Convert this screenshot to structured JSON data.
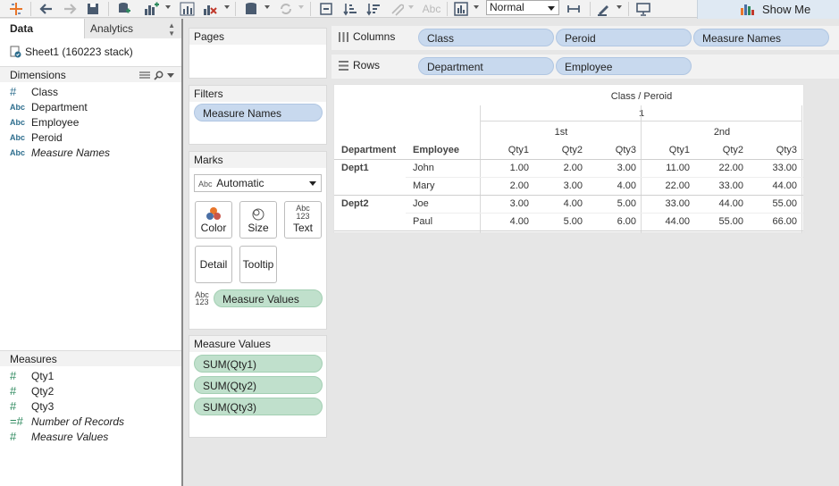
{
  "toolbar": {
    "fit_value": "Normal",
    "show_me_label": "Show Me",
    "label_button": "Abc"
  },
  "data_pane": {
    "tabs": [
      {
        "label": "Data"
      },
      {
        "label": "Analytics"
      }
    ],
    "datasource": "Sheet1 (160223 stack)",
    "dimensions_label": "Dimensions",
    "dimensions": [
      {
        "icon": "#",
        "label": "Class",
        "italic": false
      },
      {
        "icon": "Abc",
        "label": "Department",
        "italic": false
      },
      {
        "icon": "Abc",
        "label": "Employee",
        "italic": false
      },
      {
        "icon": "Abc",
        "label": "Peroid",
        "italic": false
      },
      {
        "icon": "Abc",
        "label": "Measure Names",
        "italic": true
      }
    ],
    "measures_label": "Measures",
    "measures": [
      {
        "icon": "#",
        "label": "Qty1",
        "italic": false
      },
      {
        "icon": "#",
        "label": "Qty2",
        "italic": false
      },
      {
        "icon": "#",
        "label": "Qty3",
        "italic": false
      },
      {
        "icon": "=#",
        "label": "Number of Records",
        "italic": true
      },
      {
        "icon": "#",
        "label": "Measure Values",
        "italic": true
      }
    ]
  },
  "cards": {
    "pages_title": "Pages",
    "filters_title": "Filters",
    "filters": [
      "Measure Names"
    ],
    "marks_title": "Marks",
    "marks_type_icon": "Abc",
    "marks_type": "Automatic",
    "marks_buttons": [
      "Color",
      "Size",
      "Text",
      "Detail",
      "Tooltip"
    ],
    "text_glyph_top": "Abc",
    "text_glyph_bottom": "123",
    "marks_pill": "Measure Values",
    "measure_values_title": "Measure Values",
    "measure_values": [
      "SUM(Qty1)",
      "SUM(Qty2)",
      "SUM(Qty3)"
    ]
  },
  "shelves": {
    "columns_label": "Columns",
    "columns": [
      "Class",
      "Peroid",
      "Measure Names"
    ],
    "rows_label": "Rows",
    "rows": [
      "Department",
      "Employee"
    ]
  },
  "view": {
    "top_header": "Class  /  Peroid",
    "class_value": "1",
    "periods": [
      "1st",
      "2nd"
    ],
    "row_headers": [
      "Department",
      "Employee"
    ],
    "measure_headers": [
      "Qty1",
      "Qty2",
      "Qty3",
      "Qty1",
      "Qty2",
      "Qty3"
    ],
    "rows": [
      {
        "dept": "Dept1",
        "emp": "John",
        "values": [
          "1.00",
          "2.00",
          "3.00",
          "11.00",
          "22.00",
          "33.00"
        ]
      },
      {
        "dept": "",
        "emp": "Mary",
        "values": [
          "2.00",
          "3.00",
          "4.00",
          "22.00",
          "33.00",
          "44.00"
        ]
      },
      {
        "dept": "Dept2",
        "emp": "Joe",
        "values": [
          "3.00",
          "4.00",
          "5.00",
          "33.00",
          "44.00",
          "55.00"
        ]
      },
      {
        "dept": "",
        "emp": "Paul",
        "values": [
          "4.00",
          "5.00",
          "6.00",
          "44.00",
          "55.00",
          "66.00"
        ]
      }
    ]
  },
  "colors": {
    "dimension_pill": "#c8d9ee",
    "measure_pill": "#c0e0cc",
    "field_dimension": "#2e6e8e",
    "field_measure": "#2f8a5f"
  }
}
